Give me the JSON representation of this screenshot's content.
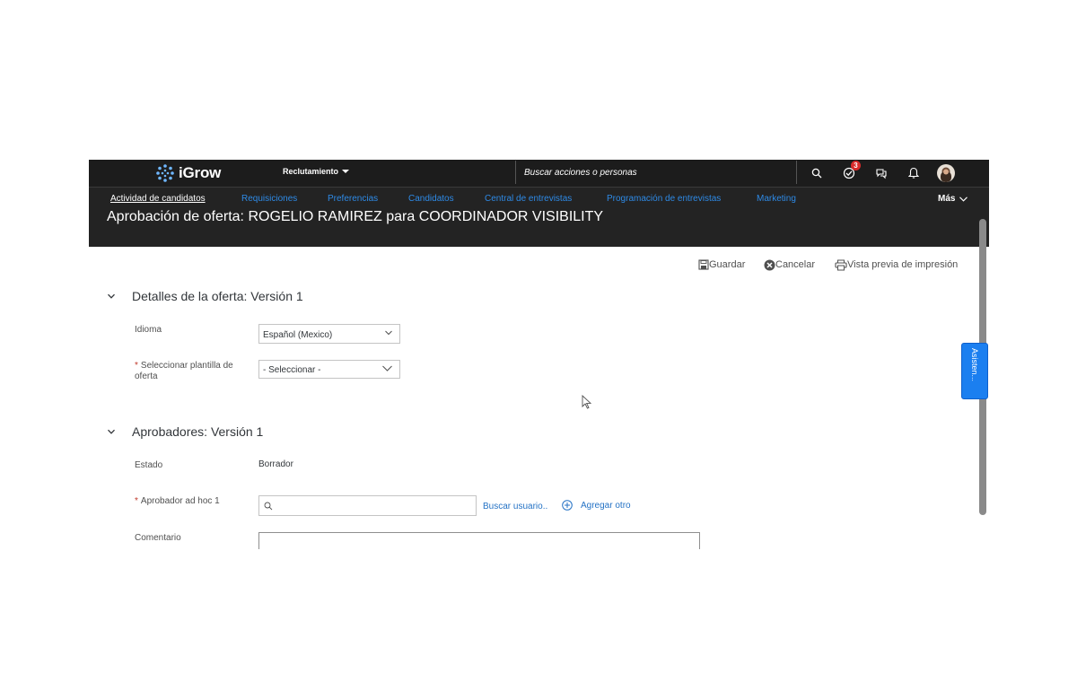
{
  "topbar": {
    "logo_text": "iGrow",
    "module_label": "Reclutamiento",
    "search_placeholder": "Buscar acciones o personas",
    "todo_badge_count": "3"
  },
  "nav": {
    "items": [
      {
        "label": "Actividad de candidatos",
        "active": true
      },
      {
        "label": "Requisiciones"
      },
      {
        "label": "Preferencias"
      },
      {
        "label": "Candidatos"
      },
      {
        "label": "Central de entrevistas"
      },
      {
        "label": "Programación de entrevistas"
      },
      {
        "label": "Marketing"
      }
    ],
    "more_label": "Más"
  },
  "page": {
    "title": "Aprobación de oferta: ROGELIO RAMIREZ para COORDINADOR VISIBILITY"
  },
  "toolbar": {
    "save_label": "Guardar",
    "cancel_label": "Cancelar",
    "print_preview_label": "Vista previa de impresión"
  },
  "offer_details": {
    "heading": "Detalles de la oferta: Versión 1",
    "language_label": "Idioma",
    "language_value": "Español (Mexico)",
    "template_label": "Seleccionar plantilla de oferta",
    "template_value": "- Seleccionar -"
  },
  "approvers": {
    "heading": "Aprobadores: Versión 1",
    "status_label": "Estado",
    "status_value": "Borrador",
    "adhoc_label": "Aprobador ad hoc 1",
    "search_user_link": "Buscar usuario..",
    "add_other_link": "Agregar otro",
    "comment_label": "Comentario"
  },
  "assistant_tab": "Asisten...",
  "colors": {
    "header_bg": "#1c1c1c",
    "nav_link": "#2e8ae6",
    "link": "#2472c5",
    "assistant_bg": "#1b7ff0",
    "badge": "#d92b2b"
  }
}
